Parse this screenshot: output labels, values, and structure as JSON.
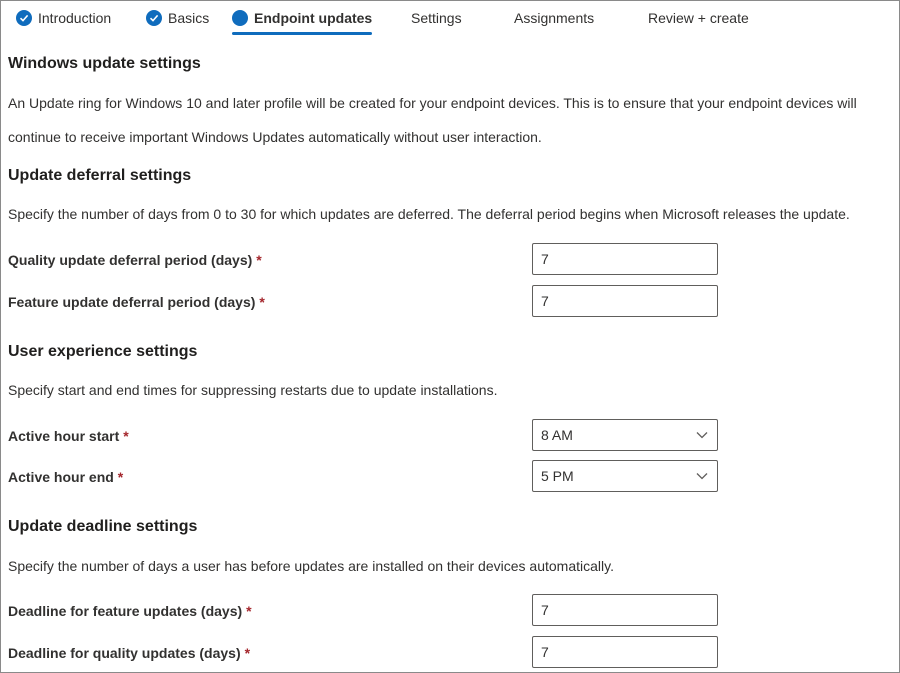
{
  "wizard": {
    "steps": [
      {
        "label": "Introduction",
        "state": "done"
      },
      {
        "label": "Basics",
        "state": "done"
      },
      {
        "label": "Endpoint updates",
        "state": "current"
      },
      {
        "label": "Settings",
        "state": "pending"
      },
      {
        "label": "Assignments",
        "state": "pending"
      },
      {
        "label": "Review + create",
        "state": "pending"
      }
    ]
  },
  "sections": {
    "windows_update": {
      "title": "Windows update settings",
      "description": "An Update ring for Windows 10 and later profile will be created for your endpoint devices. This is to ensure that your endpoint devices will continue to receive important Windows Updates automatically without user interaction."
    },
    "deferral": {
      "title": "Update deferral settings",
      "description": "Specify the number of days from 0 to 30 for which updates are deferred. The deferral period begins when Microsoft releases the update.",
      "quality_label": "Quality update deferral period (days)",
      "quality_value": "7",
      "feature_label": "Feature update deferral period (days)",
      "feature_value": "7"
    },
    "user_experience": {
      "title": "User experience settings",
      "description": "Specify start and end times for suppressing restarts due to update installations.",
      "start_label": "Active hour start",
      "start_value": "8 AM",
      "end_label": "Active hour end",
      "end_value": "5 PM"
    },
    "deadline": {
      "title": "Update deadline settings",
      "description": "Specify the number of days a user has before updates are installed on their devices automatically.",
      "feature_label": "Deadline for feature updates (days)",
      "feature_value": "7",
      "quality_label": "Deadline for quality updates (days)",
      "quality_value": "7"
    }
  },
  "required_marker": "*",
  "colors": {
    "accent": "#0f6cbd",
    "required": "#a4262c",
    "border": "#605e5c"
  },
  "icons": {
    "done": "checkmark-circle-icon",
    "current": "filled-circle-icon",
    "dropdown": "chevron-down-icon"
  }
}
